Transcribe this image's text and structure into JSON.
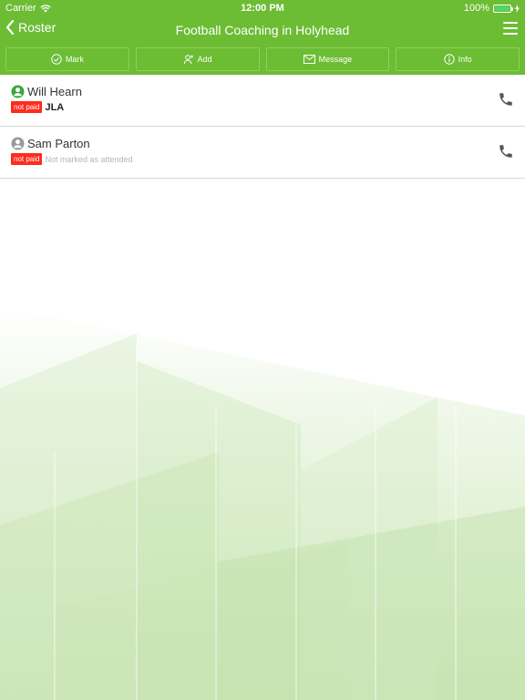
{
  "status": {
    "carrier": "Carrier",
    "time": "12:00 PM",
    "battery": "100%"
  },
  "nav": {
    "back_label": "Roster",
    "title": "Football Coaching in Holyhead"
  },
  "toolbar": {
    "mark": "Mark",
    "add": "Add",
    "message": "Message",
    "info": "Info"
  },
  "attendees": [
    {
      "name": "Will Hearn",
      "badge": "not paid",
      "detail": "JLA"
    },
    {
      "name": "Sam Parton",
      "badge": "not paid",
      "detail": "Not marked as attended"
    }
  ],
  "colors": {
    "brand": "#6cbc34",
    "badge": "#ff2b1c"
  }
}
